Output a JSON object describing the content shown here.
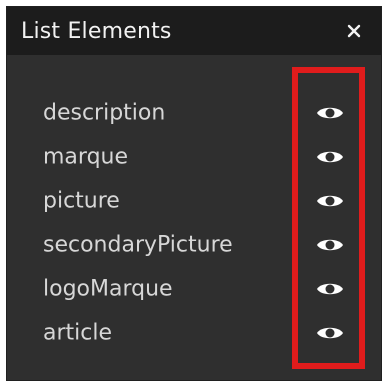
{
  "panel": {
    "title": "List Elements",
    "close_icon": "close-icon",
    "items": [
      {
        "label": "description",
        "icon": "eye-icon"
      },
      {
        "label": "marque",
        "icon": "eye-icon"
      },
      {
        "label": "picture",
        "icon": "eye-icon"
      },
      {
        "label": "secondaryPicture",
        "icon": "eye-icon"
      },
      {
        "label": "logoMarque",
        "icon": "eye-icon"
      },
      {
        "label": "article",
        "icon": "eye-icon"
      }
    ]
  },
  "colors": {
    "panel_background": "#2f2f2f",
    "title_bar_background": "#1c1c1c",
    "text": "#d7d7d7",
    "highlight": "#e01c1c"
  }
}
